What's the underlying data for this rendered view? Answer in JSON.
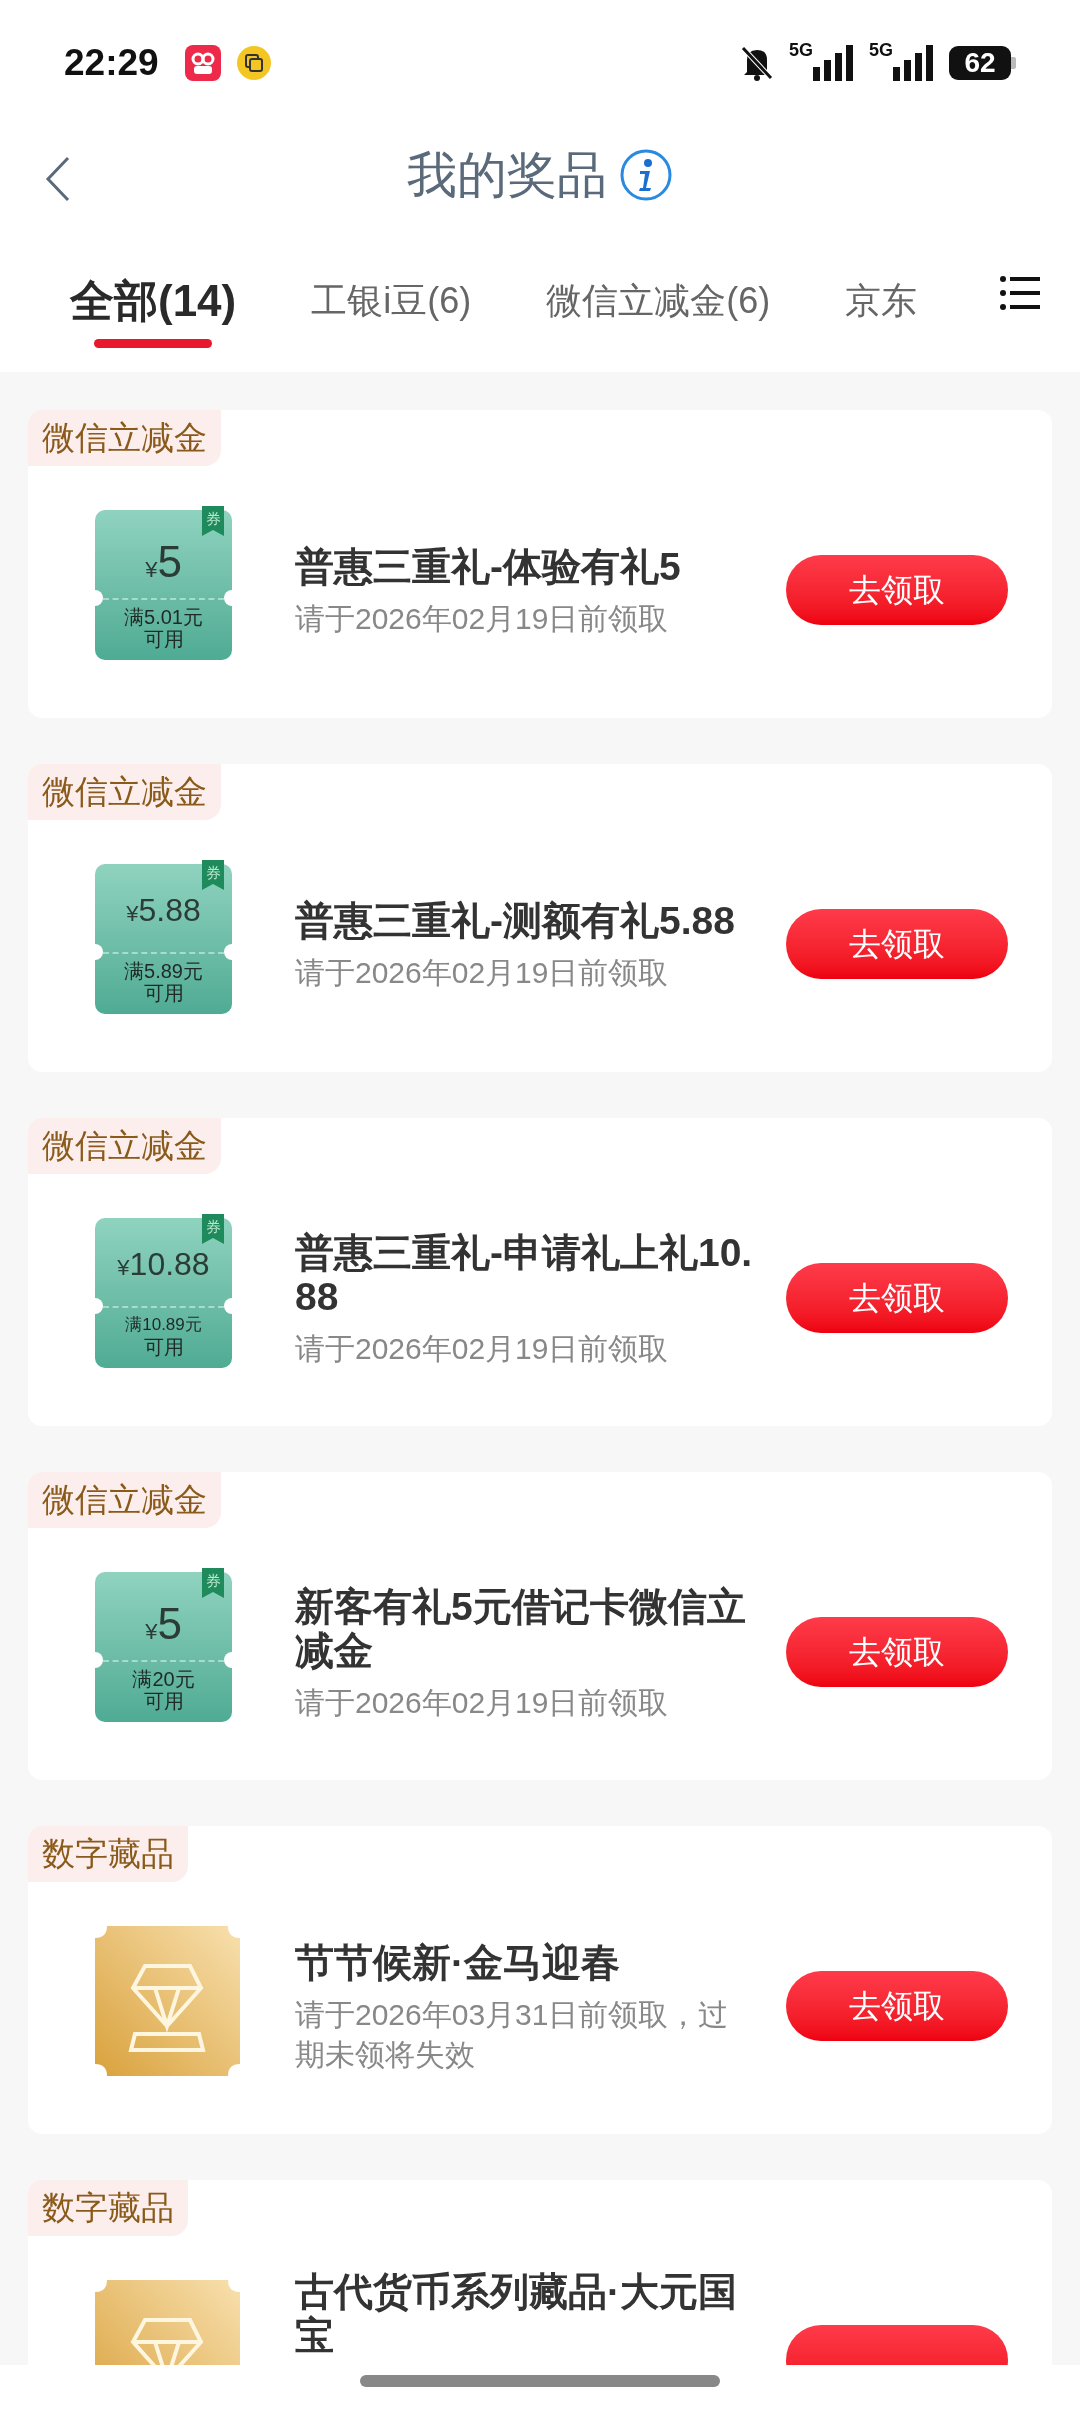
{
  "status_bar": {
    "time": "22:29",
    "network_1": "5G",
    "network_2": "5G",
    "battery": "62"
  },
  "header": {
    "title": "我的奖品"
  },
  "tabs": [
    {
      "label": "全部(14)",
      "selected": true
    },
    {
      "label": "工银i豆(6)",
      "selected": false
    },
    {
      "label": "微信立减金(6)",
      "selected": false
    },
    {
      "label": "京东",
      "selected": false
    }
  ],
  "prizes": [
    {
      "category": "微信立减金",
      "kind": "voucher",
      "badge": "券",
      "currency": "¥",
      "amount": "5",
      "condition": "满5.01元",
      "note": "可用",
      "title": "普惠三重礼-体验有礼5",
      "deadline": "请于2026年02月19日前领取",
      "button": "去领取"
    },
    {
      "category": "微信立减金",
      "kind": "voucher",
      "badge": "券",
      "currency": "¥",
      "amount": "5.88",
      "condition": "满5.89元",
      "note": "可用",
      "title": "普惠三重礼-测额有礼5.88",
      "deadline": "请于2026年02月19日前领取",
      "button": "去领取"
    },
    {
      "category": "微信立减金",
      "kind": "voucher",
      "badge": "券",
      "currency": "¥",
      "amount": "10.88",
      "condition": "满10.89元",
      "note": "可用",
      "title": "普惠三重礼-申请礼上礼10.88",
      "deadline": "请于2026年02月19日前领取",
      "button": "去领取"
    },
    {
      "category": "微信立减金",
      "kind": "voucher",
      "badge": "券",
      "currency": "¥",
      "amount": "5",
      "condition": "满20元",
      "note": "可用",
      "title": "新客有礼5元借记卡微信立减金",
      "deadline": "请于2026年02月19日前领取",
      "button": "去领取"
    },
    {
      "category": "数字藏品",
      "kind": "collectible",
      "title": "节节候新·金马迎春",
      "deadline": "请于2026年03月31日前领取，过期未领将失效",
      "button": "去领取"
    },
    {
      "category": "数字藏品",
      "kind": "collectible",
      "title": "古代货币系列藏品·大元国宝"
    }
  ]
}
